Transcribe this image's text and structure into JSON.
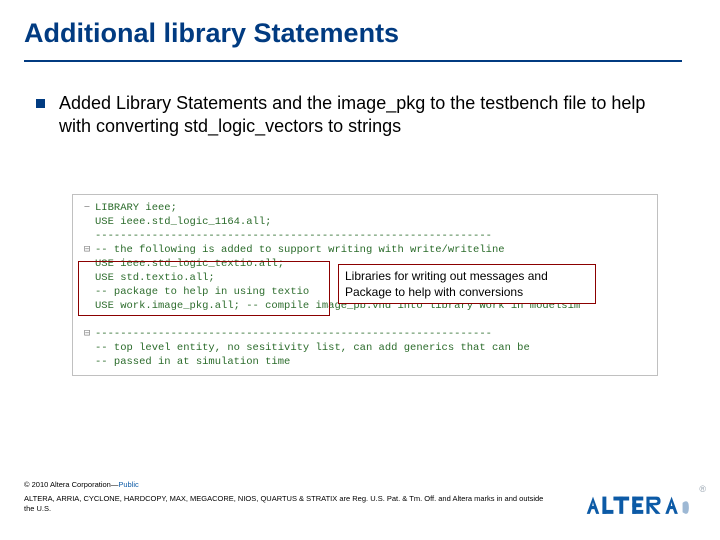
{
  "title": "Additional library Statements",
  "bullet": "Added Library Statements and the image_pkg to the testbench file to help with converting std_logic_vectors to strings",
  "code": {
    "lines": [
      "LIBRARY ieee;",
      "USE ieee.std_logic_1164.all;",
      "---------------------------------------------------------------",
      "-- the following is added to support writing with write/writeline",
      "USE ieee.std_logic_textio.all;",
      "USE std.textio.all;",
      "-- package to help in using textio",
      "USE work.image_pkg.all; -- compile image_pb.vhd into library work in modelsim",
      "",
      "---------------------------------------------------------------",
      "-- top level entity, no sesitivity list, can add generics that can be",
      "-- passed in at simulation time"
    ],
    "fold_gutter": [
      "−",
      "",
      "",
      "⊟",
      "",
      "",
      "",
      "",
      "",
      "⊟",
      "",
      ""
    ]
  },
  "annotation": {
    "label_line1": "Libraries for writing out messages and",
    "label_line2": "Package to help with conversions"
  },
  "footer": {
    "copyright": "© 2010 Altera Corporation—",
    "public_tag": "Public",
    "trademark": "ALTERA, ARRIA, CYCLONE, HARDCOPY, MAX, MEGACORE, NIOS, QUARTUS & STRATIX are Reg. U.S. Pat. & Tm. Off. and Altera marks in and outside the U.S."
  },
  "logo": {
    "brand": "ALTERA",
    "reg_mark": "®"
  }
}
